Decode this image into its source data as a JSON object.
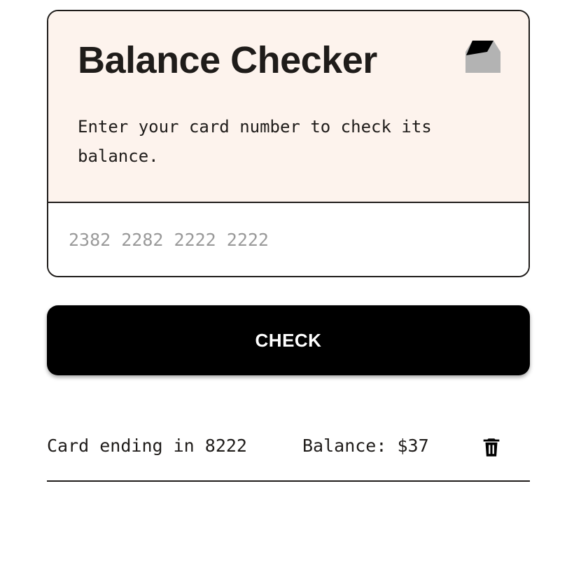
{
  "balance_card": {
    "title": "Balance Checker",
    "description": "Enter your card number to check its balance.",
    "icon": "gift-card-icon",
    "card_number_input": {
      "value": "",
      "placeholder": "2382 2282 2222 2222"
    }
  },
  "check_button": {
    "label": "CHECK"
  },
  "results": [
    {
      "card_text": "Card ending in 8222",
      "balance_text": "Balance: $37",
      "delete_icon": "trash-icon"
    }
  ],
  "colors": {
    "card_header_bg": "#fdf3ed",
    "text": "#1f1c1a",
    "button_bg": "#000000",
    "button_text": "#ffffff",
    "placeholder": "#9a9a9a"
  }
}
